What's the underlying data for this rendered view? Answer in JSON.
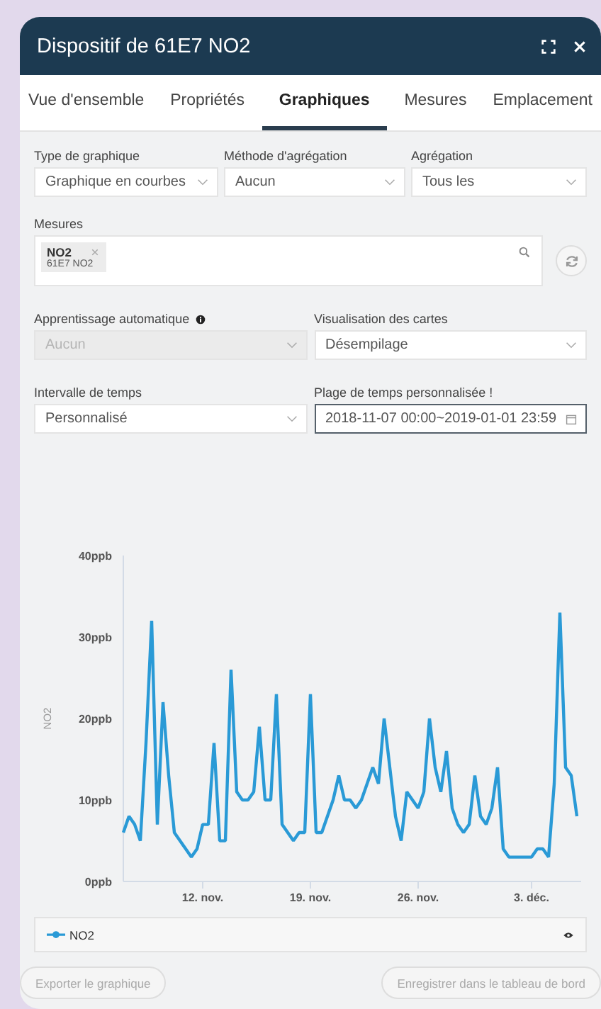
{
  "window": {
    "title": "Dispositif de 61E7 NO2"
  },
  "tabs": [
    {
      "label": "Vue d'ensemble",
      "selected": false
    },
    {
      "label": "Propriétés",
      "selected": false
    },
    {
      "label": "Graphiques",
      "selected": true
    },
    {
      "label": "Mesures",
      "selected": false
    },
    {
      "label": "Emplacement",
      "selected": false
    }
  ],
  "filters_top": [
    {
      "kind": "select",
      "label": "Type de graphique",
      "value": "Graphique en courbes",
      "disabled": false,
      "focused": false
    },
    {
      "kind": "select",
      "label": "Méthode d'agrégation",
      "value": "Aucun",
      "disabled": false,
      "focused": false
    },
    {
      "kind": "select",
      "label": "Agrégation",
      "value": "Tous les",
      "disabled": false,
      "focused": false
    }
  ],
  "measures": {
    "label": "Mesures",
    "tags": [
      {
        "name": "NO2",
        "device": "61E7 NO2"
      }
    ]
  },
  "filters_bottom": [
    {
      "kind": "select",
      "label": "Apprentissage automatique",
      "info": true,
      "value": "Aucun",
      "disabled": true,
      "focused": false
    },
    {
      "kind": "select",
      "label": "Visualisation des cartes",
      "info": false,
      "value": "Désempilage",
      "disabled": false,
      "focused": false
    },
    {
      "kind": "select",
      "label": "Intervalle de temps",
      "info": false,
      "value": "Personnalisé",
      "disabled": false,
      "focused": false
    },
    {
      "kind": "date",
      "label": "Plage de temps personnalisée !",
      "info": false,
      "value": "2018-11-07 00:00~2019-01-01 23:59",
      "disabled": false,
      "focused": true
    }
  ],
  "chart": {
    "chart_data": {
      "type": "line",
      "ylabel": "NO2",
      "categories": [
        null,
        null,
        null,
        null,
        null,
        null,
        null,
        null,
        null,
        null,
        null,
        null,
        null,
        null,
        "12. nov.",
        null,
        null,
        null,
        null,
        null,
        null,
        null,
        null,
        null,
        null,
        null,
        null,
        null,
        null,
        null,
        null,
        null,
        null,
        "19. nov.",
        null,
        null,
        null,
        null,
        null,
        null,
        null,
        null,
        null,
        null,
        null,
        null,
        null,
        null,
        null,
        null,
        null,
        null,
        "26. nov.",
        null,
        null,
        null,
        null,
        null,
        null,
        null,
        null,
        null,
        null,
        null,
        null,
        null,
        null,
        null,
        null,
        null,
        null,
        null,
        "3. déc.",
        null,
        null,
        null,
        null,
        null,
        null,
        null,
        null
      ],
      "series": [
        {
          "name": "NO2",
          "color": "#2a9ad6",
          "values": [
            6,
            8,
            7,
            5,
            17,
            32,
            7,
            22,
            13,
            6,
            5,
            4,
            3,
            4,
            7,
            7,
            17,
            5,
            5,
            26,
            11,
            10,
            10,
            11,
            19,
            10,
            10,
            23,
            7,
            6,
            5,
            6,
            6,
            23,
            6,
            6,
            8,
            10,
            13,
            10,
            10,
            9,
            10,
            12,
            14,
            12,
            20,
            14,
            8,
            5,
            11,
            10,
            9,
            11,
            20,
            14,
            11,
            16,
            9,
            7,
            6,
            7,
            13,
            8,
            7,
            9,
            14,
            4,
            3,
            3,
            3,
            3,
            3,
            4,
            4,
            3,
            12,
            33,
            14,
            13,
            8
          ]
        }
      ],
      "ylim": [
        0,
        40
      ],
      "yticks": [
        {
          "value": 0,
          "label": "0ppb"
        },
        {
          "value": 10,
          "label": "10ppb"
        },
        {
          "value": 20,
          "label": "20ppb"
        },
        {
          "value": 30,
          "label": "30ppb"
        },
        {
          "value": 40,
          "label": "40ppb"
        }
      ]
    }
  },
  "buttons": [
    {
      "label": "Exporter le graphique",
      "disabled": true
    },
    {
      "label": "Enregistrer dans le tableau de bord",
      "disabled": true
    }
  ]
}
